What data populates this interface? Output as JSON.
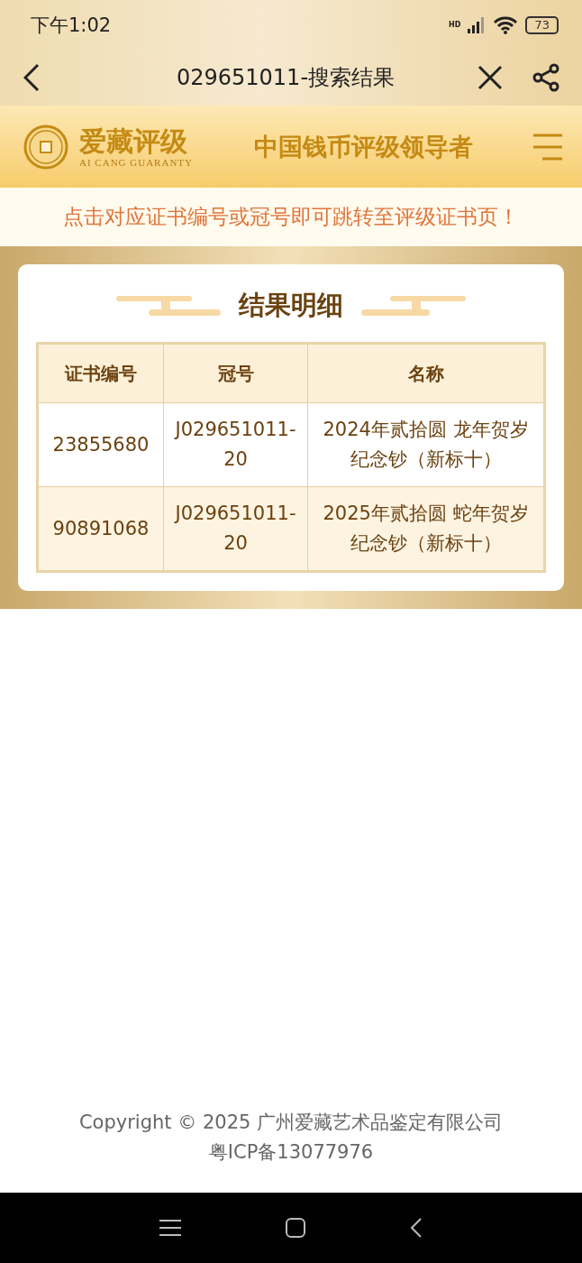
{
  "status_bar": {
    "time": "下午1:02",
    "network": "HD",
    "battery": "73"
  },
  "nav": {
    "title": "029651011-搜索结果"
  },
  "brand": {
    "name": "爱藏评级",
    "subtitle": "AI CANG GUARANTY",
    "slogan": "中国钱币评级领导者"
  },
  "notice": "点击对应证书编号或冠号即可跳转至评级证书页！",
  "results": {
    "title": "结果明细",
    "columns": [
      "证书编号",
      "冠号",
      "名称"
    ],
    "rows": [
      {
        "cert": "23855680",
        "serial": "J029651011-20",
        "name": "2024年贰拾圆 龙年贺岁纪念钞（新标十）"
      },
      {
        "cert": "90891068",
        "serial": "J029651011-20",
        "name": "2025年贰拾圆 蛇年贺岁纪念钞（新标十）"
      }
    ]
  },
  "footer": {
    "copyright": "Copyright © 2025 广州爱藏艺术品鉴定有限公司",
    "icp": "粤ICP备13077976"
  }
}
